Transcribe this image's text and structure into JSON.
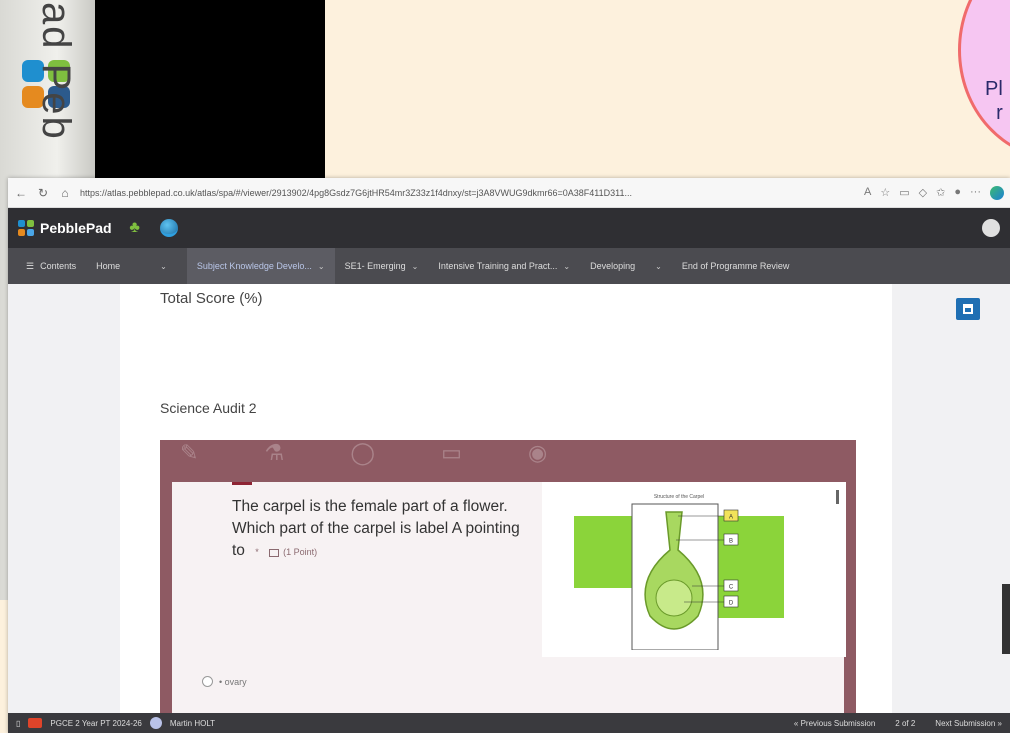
{
  "overlay": {
    "cam_logo_text": "ad Peb",
    "bubble_text": "Pl\n  r"
  },
  "browser": {
    "url": "https://atlas.pebblepad.co.uk/atlas/spa/#/viewer/2913902/4pg8Gsdz7G6jtHR54mr3Z33z1f4dnxy/st=j3A8VWUG9dkmr66=0A38F411D311..."
  },
  "app": {
    "name": "PebblePad"
  },
  "nav": {
    "contents": "Contents",
    "items": [
      {
        "label": "Home"
      },
      {
        "label": "Subject Knowledge Develo..."
      },
      {
        "label": "SE1- Emerging"
      },
      {
        "label": "Intensive Training and Pract..."
      },
      {
        "label": "Developing"
      },
      {
        "label": "End of Programme Review"
      }
    ]
  },
  "main": {
    "total_score": "Total Score (%)",
    "section_title": "Science Audit 2",
    "question": {
      "text": "The carpel is the female part of a flower. Which part of the carpel is label A pointing to",
      "required_mark": "*",
      "points": "(1 Point)",
      "diagram_title": "Structure of the Carpel",
      "labels": [
        "A",
        "B",
        "C",
        "D"
      ],
      "option_1": "• ovary"
    }
  },
  "statusbar": {
    "workspace": "PGCE 2 Year PT 2024-26",
    "user": "Martin HOLT",
    "previous": "« Previous Submission",
    "page": "2 of 2",
    "next": "Next Submission »"
  },
  "colors": {
    "banner": "#8e5a63",
    "appbar": "#2f2f33",
    "navbar": "#4b4b50",
    "accent_blue": "#1f6fb3",
    "diagram_green": "#8bd43a"
  }
}
